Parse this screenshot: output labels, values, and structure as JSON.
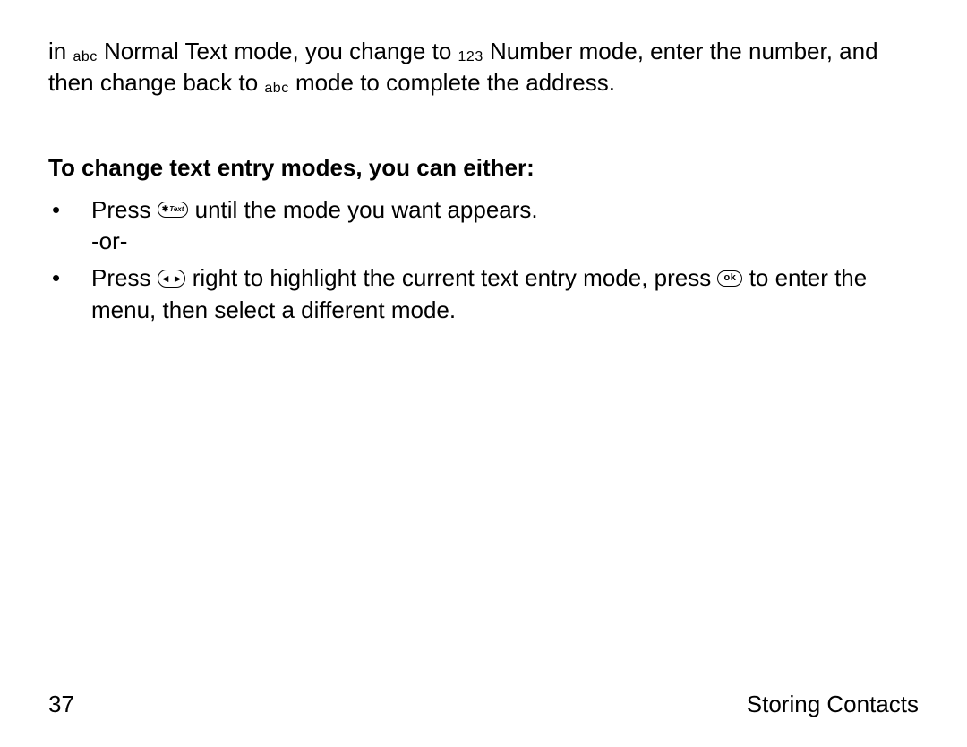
{
  "intro": {
    "p1_a": "in ",
    "icon_abc1": "abc",
    "p1_b": " Normal Text mode, you change to ",
    "icon_123": "123",
    "p1_c": " Number mode, enter the number, and then change back to ",
    "icon_abc2": "abc",
    "p1_d": " mode to complete the address."
  },
  "heading": "To change text entry modes, you can either:",
  "items": [
    {
      "pre": "Press ",
      "key": "text",
      "mid": " until the mode you want appears.",
      "or_line": "-or-"
    },
    {
      "pre": "Press  ",
      "key": "nav",
      "mid": " right to highlight the current text entry mode, press  ",
      "key2": "ok",
      "post": " to enter the menu, then select a different mode."
    }
  ],
  "footer": {
    "page": "37",
    "section": "Storing Contacts"
  }
}
